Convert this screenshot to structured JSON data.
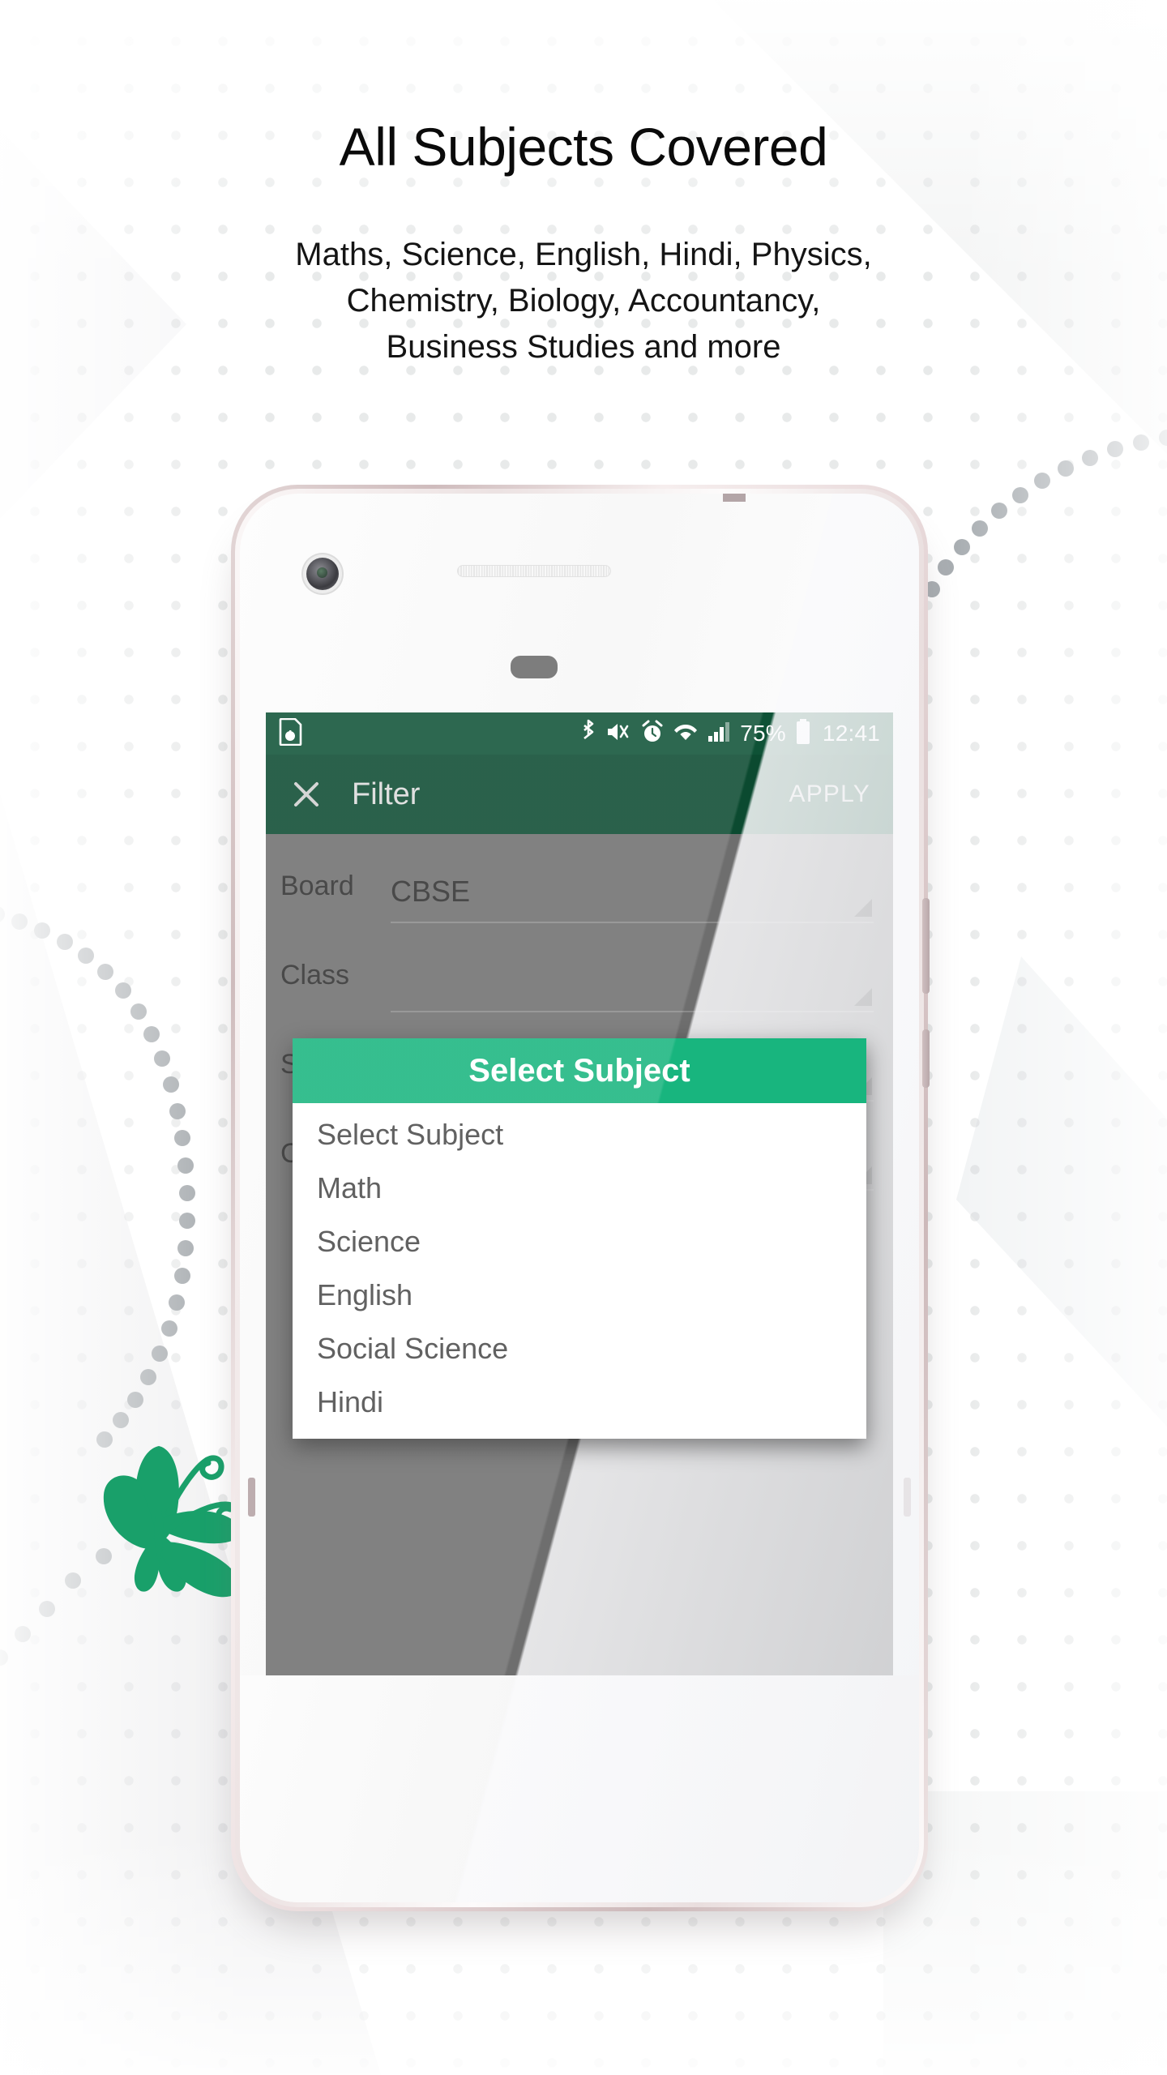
{
  "promo": {
    "headline": "All Subjects Covered",
    "subtitle_lines": [
      "Maths, Science, English, Hindi, Physics,",
      "Chemistry, Biology, Accountancy,",
      "Business Studies and more"
    ]
  },
  "colors": {
    "statusbar_green": "#0e5236",
    "appbar_green": "#0b4a30",
    "dialog_green": "#18b57e",
    "butterfly_green": "#19a06a",
    "screen_dim": "#6e6e6e"
  },
  "phone": {
    "statusbar": {
      "left_icon": "sim-card-icon",
      "icons": [
        "bluetooth-icon",
        "mute-vibrate-icon",
        "alarm-icon",
        "wifi-icon",
        "cellular-signal-icon"
      ],
      "battery_percent": "75%",
      "battery_icon": "battery-icon",
      "time": "12:41"
    },
    "appbar": {
      "close_icon": "close-icon",
      "title": "Filter",
      "apply_label": "APPLY"
    },
    "filter_rows": [
      {
        "label": "Board",
        "value": "CBSE",
        "dropdown_icon": "dropdown-triangle-icon"
      },
      {
        "label": "Class",
        "value": "",
        "dropdown_icon": "dropdown-triangle-icon"
      },
      {
        "label": "Subject",
        "value": "",
        "dropdown_icon": "dropdown-triangle-icon"
      },
      {
        "label": "Chapter",
        "value": "",
        "dropdown_icon": "dropdown-triangle-icon"
      }
    ],
    "dialog": {
      "title": "Select Subject",
      "items": [
        "Select Subject",
        "Math",
        "Science",
        "English",
        "Social Science",
        "Hindi"
      ]
    }
  }
}
